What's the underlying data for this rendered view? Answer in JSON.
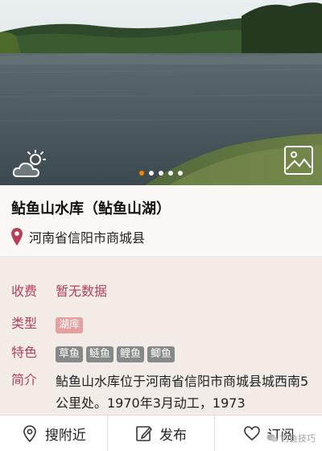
{
  "hero": {
    "weather_icon": "cloud-sun-icon",
    "gallery_icon": "image-icon",
    "carousel": {
      "total": 5,
      "active": 0
    }
  },
  "spot": {
    "title": "鲇鱼山水库（鲇鱼山湖）",
    "location": "河南省信阳市商城县"
  },
  "details": {
    "fee_label": "收费",
    "fee_value": "暂无数据",
    "type_label": "类型",
    "type_tag": "湖库",
    "feature_label": "特色",
    "fish_tags": [
      "草鱼",
      "鲢鱼",
      "鲤鱼",
      "鲫鱼"
    ],
    "intro_label": "简介",
    "intro_text": "鲇鱼山水库位于河南省信阳市商城县城西南5公里处。1970年3月动工，1973"
  },
  "bottom_nav": {
    "nearby": "搜附近",
    "publish": "发布",
    "subscribe": "订阅"
  },
  "watermark": "钓鱼技巧",
  "colors": {
    "accent_red": "#b4405a",
    "carousel_active": "#ff8a00",
    "lake_tag": "#e5a0a0",
    "fish_tag": "#838a87"
  }
}
